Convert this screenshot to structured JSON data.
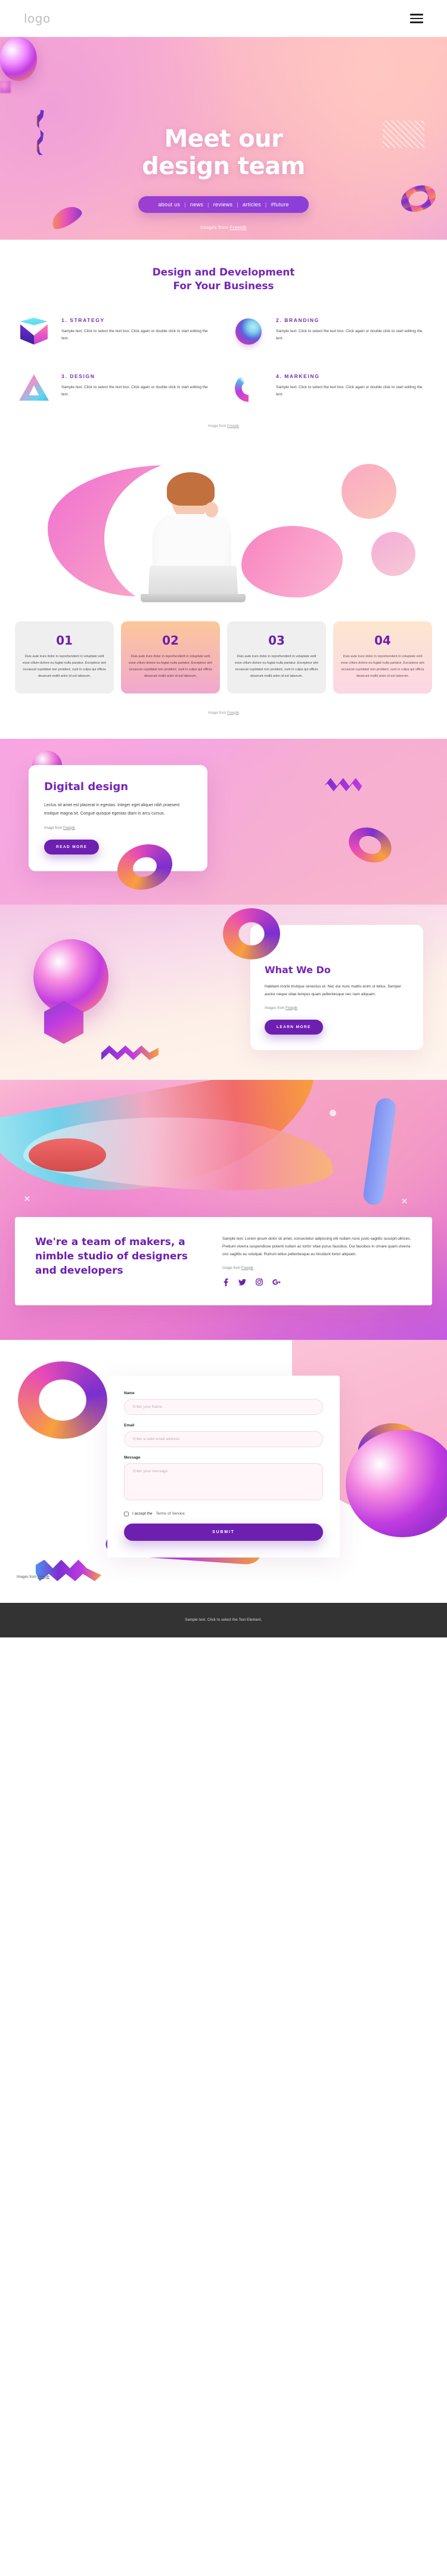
{
  "topbar": {
    "logo": "logo",
    "menu_icon": "hamburger-icon"
  },
  "hero": {
    "title_line1": "Meet our",
    "title_line2": "design team",
    "nav": [
      {
        "label": "about us"
      },
      {
        "label": "news"
      },
      {
        "label": "reviews"
      },
      {
        "label": "articles"
      },
      {
        "label": "#future"
      }
    ],
    "separator": "|",
    "credit_prefix": "Images from ",
    "credit_link": "Freepik"
  },
  "services": {
    "title_line1": "Design and Development",
    "title_line2": "For Your Business",
    "items": [
      {
        "heading": "1. STRATEGY",
        "body": "Sample text. Click to select the text box. Click again or double click to start editing the text.",
        "icon": "cube-icon"
      },
      {
        "heading": "2. BRANDING",
        "body": "Sample text. Click to select the text box. Click again or double click to start editing the text.",
        "icon": "sphere-icon"
      },
      {
        "heading": "3. DESIGN",
        "body": "Sample text. Click to select the text box. Click again or double click to start editing the text.",
        "icon": "triangle-icon"
      },
      {
        "heading": "4. MARKEING",
        "body": "Sample text. Click to select the text box. Click again or double click to start editing the text.",
        "icon": "arc-icon"
      }
    ],
    "credit_prefix": "Image from ",
    "credit_link": "Freepik"
  },
  "team": {
    "cards": [
      {
        "number": "01",
        "text": "Duis aute irure dolor in reprehenderit in voluptate velit esse cillum dolore eu fugiat nulla pariatur. Excepteur sint occaecat cupidatat non proident, sunt in culpa qui officia deserunt mollit anim id est laborum."
      },
      {
        "number": "02",
        "text": "Duis aute irure dolor in reprehenderit in voluptate velit esse cillum dolore eu fugiat nulla pariatur. Excepteur sint occaecat cupidatat non proident, sunt in culpa qui officia deserunt mollit anim id est laborum."
      },
      {
        "number": "03",
        "text": "Duis aute irure dolor in reprehenderit in voluptate velit esse cillum dolore eu fugiat nulla pariatur. Excepteur sint occaecat cupidatat non proident, sunt in culpa qui officia deserunt mollit anim id est laborum."
      },
      {
        "number": "04",
        "text": "Duis aute irure dolor in reprehenderit in voluptate velit esse cillum dolore eu fugiat nulla pariatur. Excepteur sint occaecat cupidatat non proident, sunt in culpa qui officia deserunt mollit anim id est laborum."
      }
    ],
    "credit_prefix": "Image from ",
    "credit_link": "Freepik"
  },
  "digital": {
    "title": "Digital design",
    "body": "Lectus sit amet est placerat in egestas. Integer eget aliquet nibh praesent tristique magna sit. Congue quisque egestas diam in arcu cursus.",
    "credit_prefix": "Image from ",
    "credit_link": "Freepik",
    "button": "READ MORE"
  },
  "what_we_do": {
    "title": "What We Do",
    "body": "Habitant morbi tristique senectus et. Nec dui nunc mattis enim ut tellus. Semper auctor neque vitae tempus quam pellentesque nec nam aliquam.",
    "credit_prefix": "Images from ",
    "credit_link": "Freepik",
    "button": "LEARN MORE"
  },
  "makers": {
    "title": "We're a team of makers, a nimble studio of designers and developers",
    "body": "Sample text. Lorem ipsum dolor sit amet, consectetur adipiscing elit nullam nunc justo sagittis suscipit ultrices. Pretium viverra suspendisse potenti nullam ac tortor vitae purus faucibus. Dui faucibus in ornare quam viverra orci sagittis eu volutpat. Rutrum tellus pellentesque eu tincidunt tortor aliquam.",
    "credit_prefix": "Image from ",
    "credit_link": "Freepik",
    "socials": [
      {
        "name": "facebook-icon"
      },
      {
        "name": "twitter-icon"
      },
      {
        "name": "instagram-icon"
      },
      {
        "name": "googleplus-icon"
      }
    ]
  },
  "contact": {
    "name_label": "Name",
    "name_placeholder": "Enter your Name",
    "email_label": "Email",
    "email_placeholder": "Enter a valid email address",
    "message_label": "Message",
    "message_placeholder": "Enter your message",
    "tos_prefix": "I accept the ",
    "tos_link": "Terms of Service",
    "submit": "SUBMIT",
    "credit_prefix": "Images from ",
    "credit_link": "Freepik"
  },
  "footer": {
    "text": "Sample text. Click to select the Text Element."
  },
  "colors": {
    "purple": "#6d1fb0",
    "heading_purple": "#7426b8",
    "footer_bg": "#333333",
    "pink": "#f49ed0",
    "orange": "#f9a03c"
  }
}
